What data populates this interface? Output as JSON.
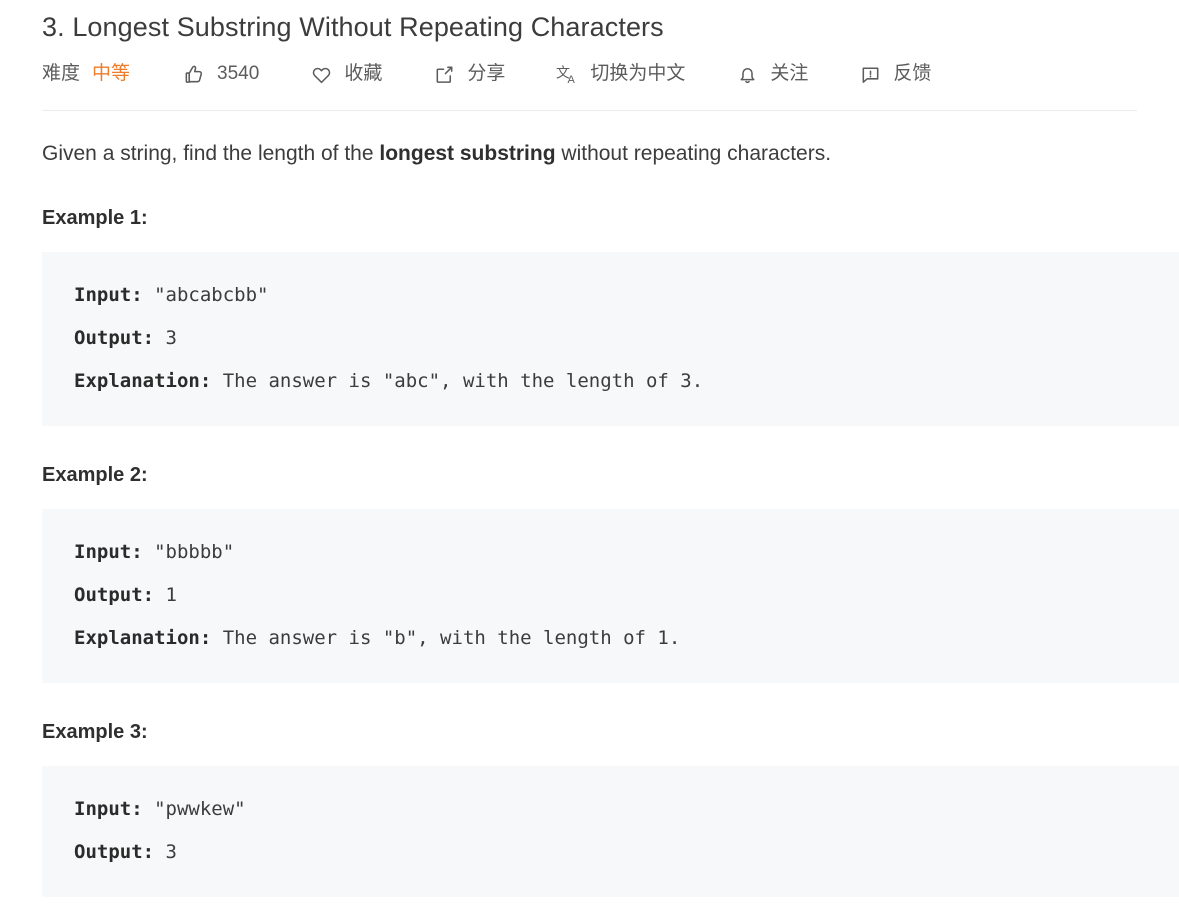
{
  "problem": {
    "title": "3. Longest Substring Without Repeating Characters",
    "description_prefix": "Given a string, find the length of the ",
    "description_bold": "longest substring",
    "description_suffix": " without repeating characters."
  },
  "meta": {
    "difficulty_label": "难度",
    "difficulty_value": "中等",
    "difficulty_color": "#ef7c2a",
    "like_icon": "thumbs-up-icon",
    "like_count": "3540",
    "favorite_icon": "heart-icon",
    "favorite_label": "收藏",
    "share_icon": "share-icon",
    "share_label": "分享",
    "translate_icon": "translate-icon",
    "translate_label": "切换为中文",
    "follow_icon": "bell-icon",
    "follow_label": "关注",
    "feedback_icon": "feedback-icon",
    "feedback_label": "反馈"
  },
  "examples": [
    {
      "heading": "Example 1:",
      "input_key": "Input:",
      "input_value": " \"abcabcbb\"",
      "output_key": "Output:",
      "output_value": " 3",
      "explanation_key": "Explanation:",
      "explanation_value": " The answer is \"abc\", with the length of 3."
    },
    {
      "heading": "Example 2:",
      "input_key": "Input:",
      "input_value": " \"bbbbb\"",
      "output_key": "Output:",
      "output_value": " 1",
      "explanation_key": "Explanation:",
      "explanation_value": " The answer is \"b\", with the length of 1."
    },
    {
      "heading": "Example 3:",
      "input_key": "Input:",
      "input_value": " \"pwwkew\"",
      "output_key": "Output:",
      "output_value": " 3"
    }
  ]
}
